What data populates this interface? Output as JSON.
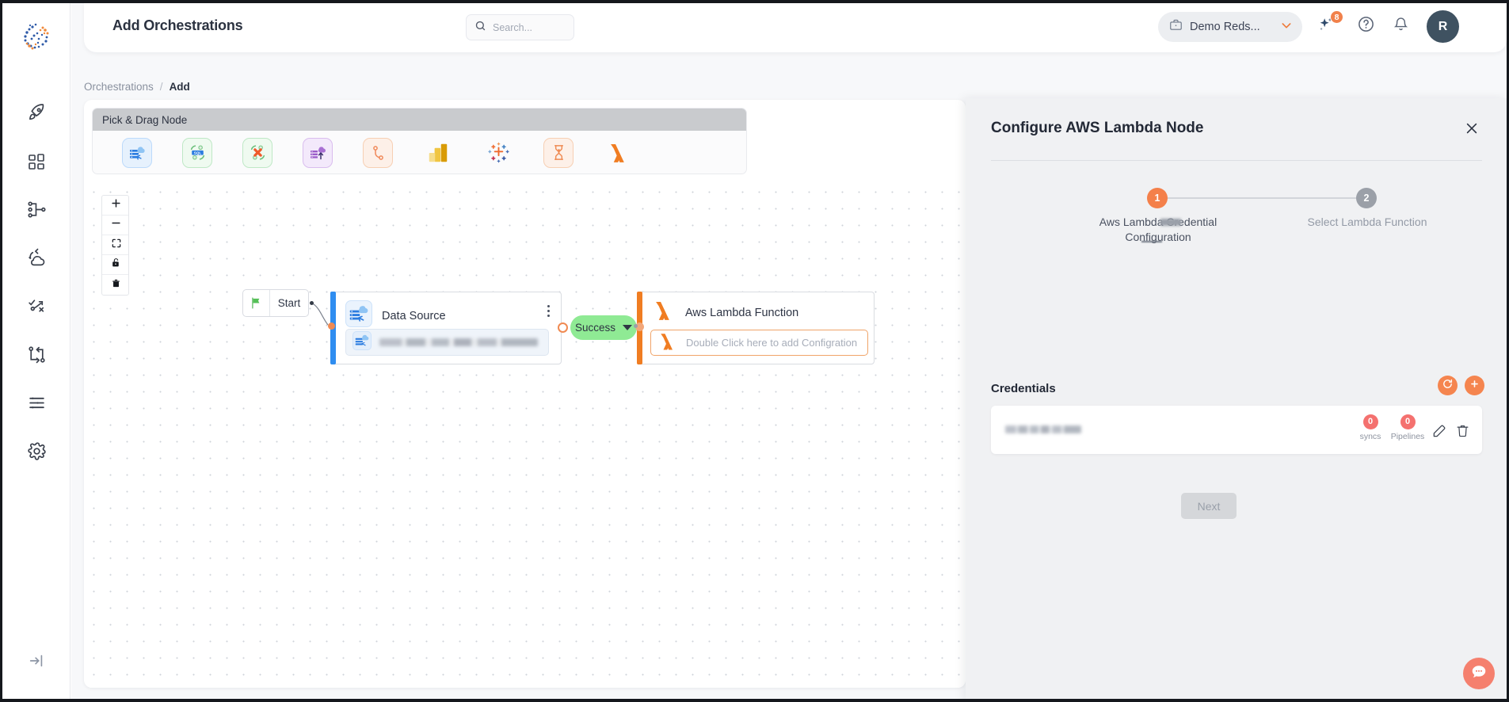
{
  "window": {
    "page_title": "Add Orchestrations"
  },
  "header": {
    "title": "Add Orchestrations",
    "search": {
      "placeholder": "Search...",
      "value": ""
    },
    "org_selector": {
      "label": "Demo Reds...",
      "icon": "briefcase-icon"
    },
    "ai_badge_count": "8",
    "avatar_initial": "R"
  },
  "breadcrumb": {
    "parent": "Orchestrations",
    "separator": "/",
    "current": "Add"
  },
  "sidebar": {
    "logo": "app-logo",
    "items": [
      {
        "name": "rocket",
        "icon": "rocket-icon"
      },
      {
        "name": "dashboard",
        "icon": "grid-icon"
      },
      {
        "name": "pipelines",
        "icon": "hierarchy-icon"
      },
      {
        "name": "sync",
        "icon": "cloud-sync-icon"
      },
      {
        "name": "transform",
        "icon": "route-x-icon"
      },
      {
        "name": "orchestrations",
        "icon": "workflow-loop-icon"
      },
      {
        "name": "logs",
        "icon": "list-lines-icon"
      },
      {
        "name": "settings",
        "icon": "gear-icon"
      }
    ],
    "collapse": "collapse-sidebar-icon"
  },
  "palette": {
    "header": "Pick & Drag Node",
    "nodes": [
      {
        "name": "data-source",
        "icon": "database-cloud-icon",
        "tile": "t-blue"
      },
      {
        "name": "sql-node",
        "icon": "sql-refresh-icon",
        "tile": "t-green"
      },
      {
        "name": "no-sql-node",
        "icon": "x-refresh-icon",
        "tile": "t-green"
      },
      {
        "name": "data-target",
        "icon": "database-upload-icon",
        "tile": "t-purple"
      },
      {
        "name": "branch-node",
        "icon": "branch-icon",
        "tile": "t-peach"
      },
      {
        "name": "power-bi",
        "icon": "power-bi-icon",
        "tile": "t-plain"
      },
      {
        "name": "tableau",
        "icon": "tableau-icon",
        "tile": "t-plain"
      },
      {
        "name": "wait-node",
        "icon": "hourglass-icon",
        "tile": "t-peach"
      },
      {
        "name": "aws-lambda",
        "icon": "lambda-icon",
        "tile": "t-plain"
      }
    ]
  },
  "canvas": {
    "tools": [
      {
        "name": "zoom-in",
        "icon": "plus-icon"
      },
      {
        "name": "zoom-out",
        "icon": "minus-icon"
      },
      {
        "name": "fit-view",
        "icon": "fit-screen-icon"
      },
      {
        "name": "lock",
        "icon": "lock-icon"
      },
      {
        "name": "delete",
        "icon": "trash-icon"
      }
    ],
    "nodes": {
      "start": {
        "label": "Start",
        "icon": "green-flag-icon"
      },
      "data_source": {
        "title": "Data Source",
        "icon": "database-cloud-icon",
        "sub_value": ""
      },
      "edge_status": {
        "label": "Success",
        "caret": "chevron-down-icon"
      },
      "lambda": {
        "title": "Aws Lambda Function",
        "icon": "lambda-icon",
        "placeholder": "Double Click here to add Configration"
      }
    }
  },
  "drawer": {
    "title": "Configure AWS Lambda Node",
    "close": "close-icon",
    "steps": [
      {
        "number": "1",
        "label": "Aws Lambda Credential Configuration",
        "state": "active"
      },
      {
        "number": "2",
        "label": "Select Lambda Function",
        "state": "inactive"
      }
    ],
    "credentials": {
      "section_title": "Credentials",
      "refresh_icon": "refresh-icon",
      "add_icon": "plus-icon",
      "rows": [
        {
          "name": "",
          "syncs_count": "0",
          "syncs_label": "syncs",
          "pipelines_count": "0",
          "pipelines_label": "Pipelines",
          "edit_icon": "edit-icon",
          "delete_icon": "trash-icon"
        }
      ]
    },
    "next_label": "Next"
  },
  "chat": {
    "icon": "chat-bubble-icon"
  },
  "colors": {
    "accent_orange": "#f4804a",
    "lambda_orange": "#f07d22",
    "success_green": "#8fea94",
    "source_blue": "#2f8df0",
    "badge_red": "#f4716f",
    "chat_coral": "#f5806e"
  }
}
